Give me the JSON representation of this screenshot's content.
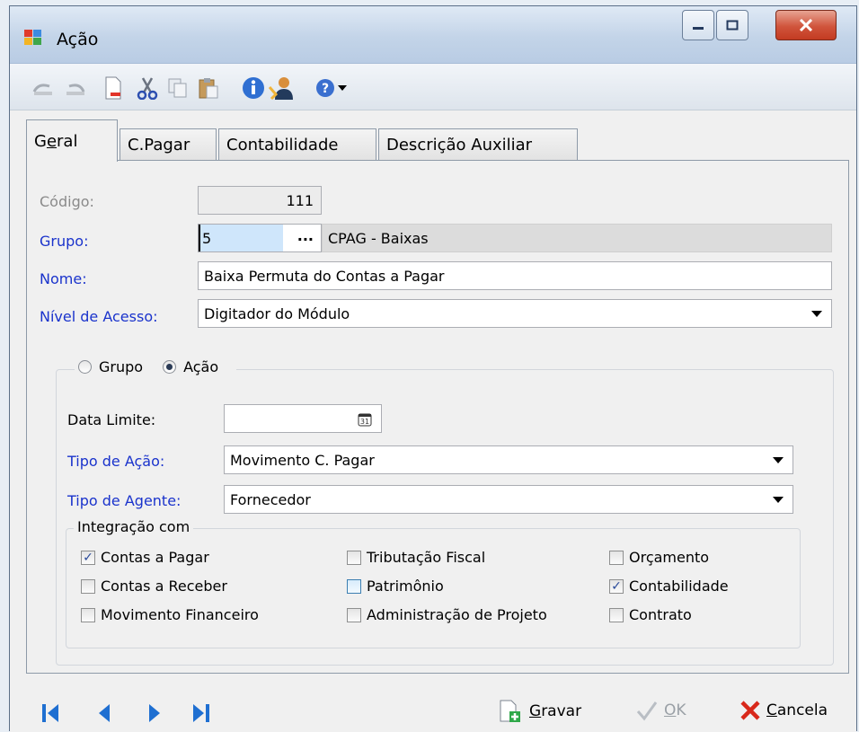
{
  "window": {
    "title": "Ação",
    "buttons": [
      "minimize",
      "maximize",
      "close"
    ]
  },
  "toolbar": {
    "icons": [
      "undo-icon",
      "redo-icon",
      "new-icon",
      "cut-icon",
      "copy-icon",
      "paste-icon",
      "info-icon",
      "user-icon",
      "help-icon",
      "dropdown-arrow-icon"
    ]
  },
  "tabs": [
    {
      "label": "Geral",
      "accel": "e",
      "active": true
    },
    {
      "label": "C.Pagar",
      "active": false
    },
    {
      "label": "Contabilidade",
      "active": false
    },
    {
      "label": "Descrição Auxiliar",
      "active": false
    }
  ],
  "form": {
    "codigo": {
      "label": "Código:",
      "value": "111"
    },
    "grupo": {
      "label": "Grupo:",
      "value": "5",
      "ellipsis": "...",
      "description": "CPAG - Baixas"
    },
    "nome": {
      "label": "Nome:",
      "value": "Baixa Permuta do Contas a Pagar"
    },
    "nivel": {
      "label": "Nível de Acesso:",
      "value": "Digitador do Módulo"
    }
  },
  "scope": {
    "options": [
      {
        "label": "Grupo",
        "selected": false
      },
      {
        "label": "Ação",
        "selected": true
      }
    ],
    "data_limite": {
      "label": "Data Limite:",
      "value": ""
    },
    "tipo_acao": {
      "label": "Tipo de Ação:",
      "value": "Movimento C. Pagar"
    },
    "tipo_agente": {
      "label": "Tipo de Agente:",
      "value": "Fornecedor"
    }
  },
  "integracao": {
    "title": "Integração com",
    "columns": [
      [
        {
          "label": "Contas a Pagar",
          "checked": true
        },
        {
          "label": "Contas a Receber",
          "checked": false
        },
        {
          "label": "Movimento Financeiro",
          "checked": false
        }
      ],
      [
        {
          "label": "Tributação Fiscal",
          "checked": false
        },
        {
          "label": "Patrimônio",
          "checked": false
        },
        {
          "label": "Administração de Projeto",
          "checked": false
        }
      ],
      [
        {
          "label": "Orçamento",
          "checked": false
        },
        {
          "label": "Contabilidade",
          "checked": true
        },
        {
          "label": "Contrato",
          "checked": false
        }
      ]
    ]
  },
  "actions": {
    "gravar": {
      "accel": "G",
      "rest": "ravar"
    },
    "ok": {
      "accel": "O",
      "rest": "K",
      "enabled": false
    },
    "cancela": {
      "accel": "C",
      "rest": "ancela"
    }
  },
  "colors": {
    "required_label": "#1a33cc",
    "disabled_label": "#8a8a8a",
    "nav_arrow": "#1f6fd1",
    "cancel_x": "#d8281a"
  }
}
